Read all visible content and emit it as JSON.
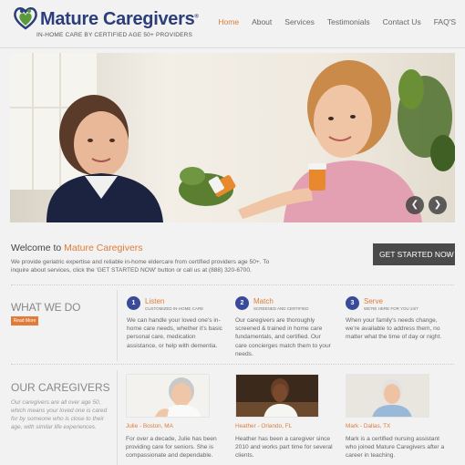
{
  "header": {
    "logo_text": "Mature Caregivers",
    "logo_mark": "®",
    "tagline": "IN-HOME CARE BY CERTIFIED AGE 50+ PROVIDERS"
  },
  "nav": {
    "items": [
      "Home",
      "About",
      "Services",
      "Testimonials",
      "Contact Us",
      "FAQ'S"
    ],
    "active": "Home"
  },
  "slider": {
    "prev_icon": "chevron-left-icon",
    "next_icon": "chevron-right-icon"
  },
  "welcome": {
    "title_prefix": "Welcome to ",
    "title_brand": "Mature Caregivers",
    "body": "We provide geriatric expertise and reliable in-home eldercare from certified providers age 50+. To inquire about services, click the 'GET STARTED NOW' button or call us at (888) 320-6700.",
    "cta_label": "GET STARTED NOW",
    "cta_icon": "double-chevron-right-icon"
  },
  "what_we_do": {
    "title": "WHAT WE DO",
    "read_more": "Read More",
    "steps": [
      {
        "num": "1",
        "title": "Listen",
        "subtitle": "CUSTOMIZED IN-HOME CARE",
        "body": "We can handle your loved one's in-home care needs, whether it's basic personal care, medication assistance, or help with dementia."
      },
      {
        "num": "2",
        "title": "Match",
        "subtitle": "SCREENED AND CERTIFIED",
        "body": "Our caregivers are thoroughly screened & trained in home care fundamentals, and certified. Our care concierges match them to your needs."
      },
      {
        "num": "3",
        "title": "Serve",
        "subtitle": "WE'RE HERE FOR YOU 24/7",
        "body": "When your family's needs change, we're available to address them, no matter what the time of day or night."
      }
    ]
  },
  "caregivers": {
    "title": "OUR CAREGIVERS",
    "body": "Our caregivers are all over age 50, which means your loved one is cared for by someone who is close to their age, with similar life experiences.",
    "people": [
      {
        "name": "Julie - Boston, MA",
        "body": "For over a decade, Julie has been providing care for seniors. She is compassionate and dependable."
      },
      {
        "name": "Heather - Orlando, FL",
        "body": "Heather has been a caregiver since 2010 and works part time for several clients."
      },
      {
        "name": "Mark - Dallas, TX",
        "body": "Mark is a certified nursing assistant who joined Mature Caregivers after a career in teaching."
      }
    ]
  },
  "colors": {
    "brand_blue": "#2c3e7a",
    "accent_orange": "#e07b39",
    "step_circle": "#3a4a9a",
    "cta_bg": "#4a4a4a"
  }
}
